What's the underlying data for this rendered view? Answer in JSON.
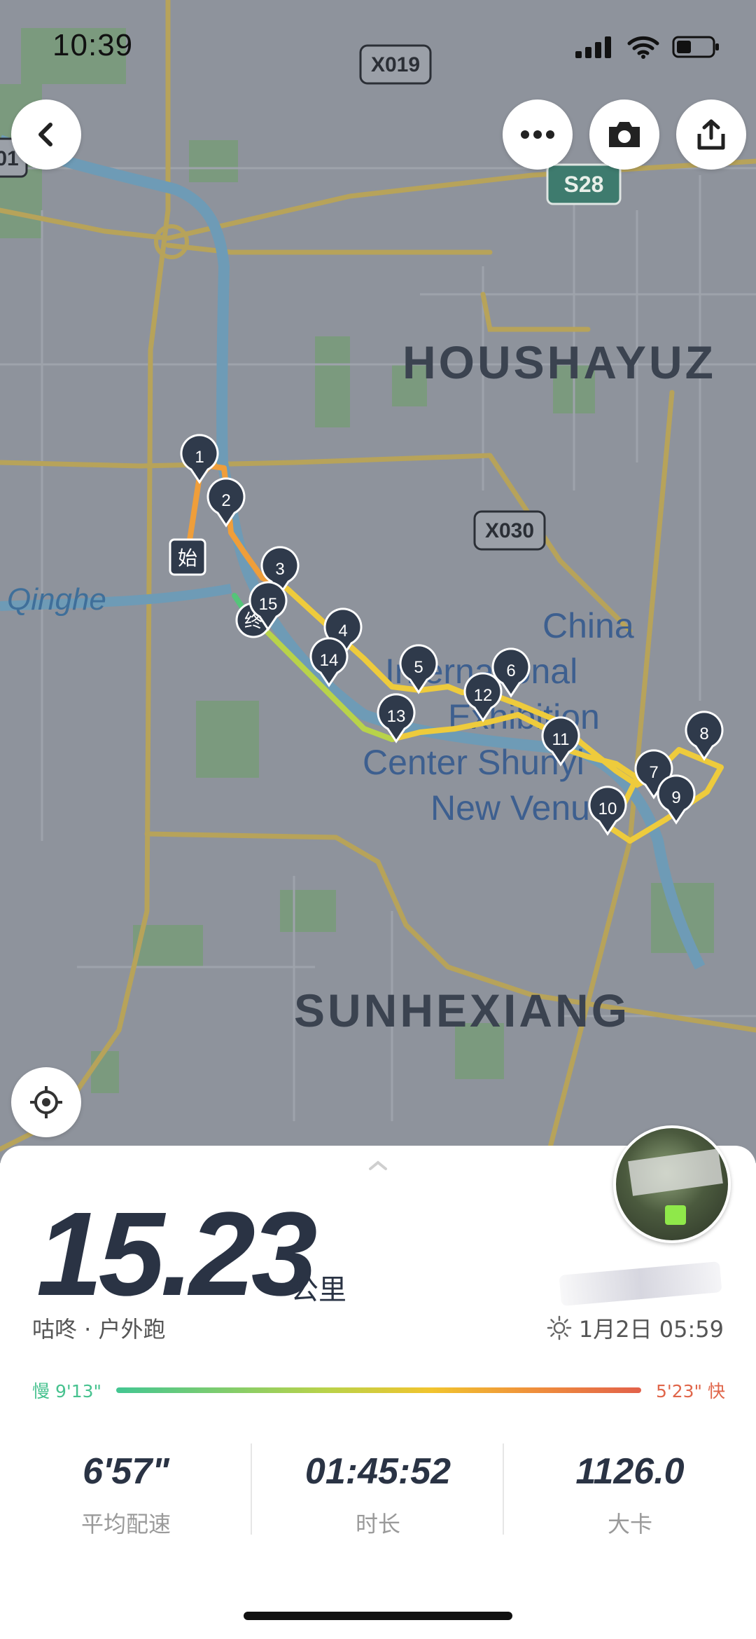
{
  "status_bar": {
    "time": "10:39"
  },
  "map": {
    "road_badges": [
      "X019",
      "S28",
      "X030"
    ],
    "left_edge_badge": "01",
    "area_labels": {
      "district_north": "HOUSHAYUZ",
      "district_south": "SUNHEXIANG",
      "river": "Qinghe",
      "venue_line1": "China",
      "venue_line2": "International",
      "venue_line3": "Exhibition",
      "venue_line4": "Center Shunyi",
      "venue_line5": "New Venue"
    },
    "start_marker": "始",
    "end_marker": "终",
    "km_markers": [
      "1",
      "2",
      "3",
      "4",
      "5",
      "6",
      "7",
      "8",
      "9",
      "10",
      "11",
      "12",
      "13",
      "14",
      "15"
    ]
  },
  "header_buttons": {
    "back": "back",
    "more": "more",
    "camera": "camera",
    "share": "share"
  },
  "summary": {
    "distance": "15.23",
    "unit": "公里",
    "source": "咕咚 · 户外跑",
    "date": "1月2日 05:59"
  },
  "pace_legend": {
    "slow": "慢 9'13\"",
    "fast": "5'23\" 快",
    "colors": [
      "#43c692",
      "#f1c42e",
      "#e2614a"
    ]
  },
  "stats": [
    {
      "value": "6'57\"",
      "label": "平均配速"
    },
    {
      "value": "01:45:52",
      "label": "时长"
    },
    {
      "value": "1126.0",
      "label": "大卡"
    }
  ]
}
